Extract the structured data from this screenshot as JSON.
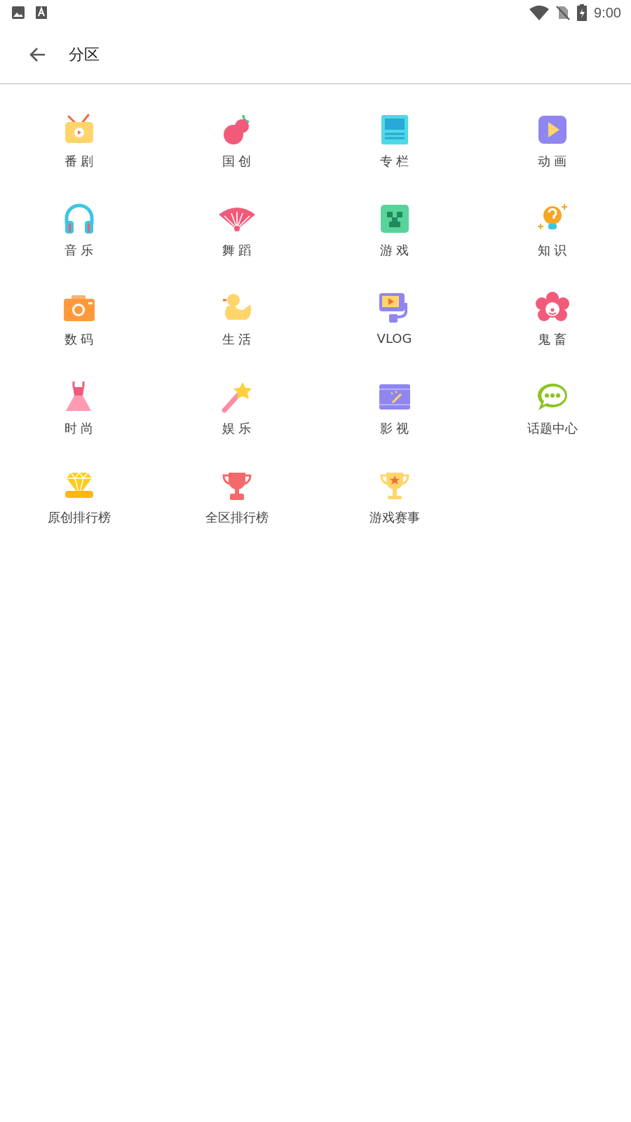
{
  "status_bar": {
    "time": "9:00"
  },
  "header": {
    "title": "分区"
  },
  "categories": [
    {
      "label": "番 剧"
    },
    {
      "label": "国 创"
    },
    {
      "label": "专 栏"
    },
    {
      "label": "动 画"
    },
    {
      "label": "音 乐"
    },
    {
      "label": "舞 蹈"
    },
    {
      "label": "游 戏"
    },
    {
      "label": "知 识"
    },
    {
      "label": "数 码"
    },
    {
      "label": "生 活"
    },
    {
      "label": "VLOG"
    },
    {
      "label": "鬼 畜"
    },
    {
      "label": "时 尚"
    },
    {
      "label": "娱 乐"
    },
    {
      "label": "影 视"
    },
    {
      "label": "话题中心"
    },
    {
      "label": "原创排行榜"
    },
    {
      "label": "全区排行榜"
    },
    {
      "label": "游戏赛事"
    }
  ]
}
